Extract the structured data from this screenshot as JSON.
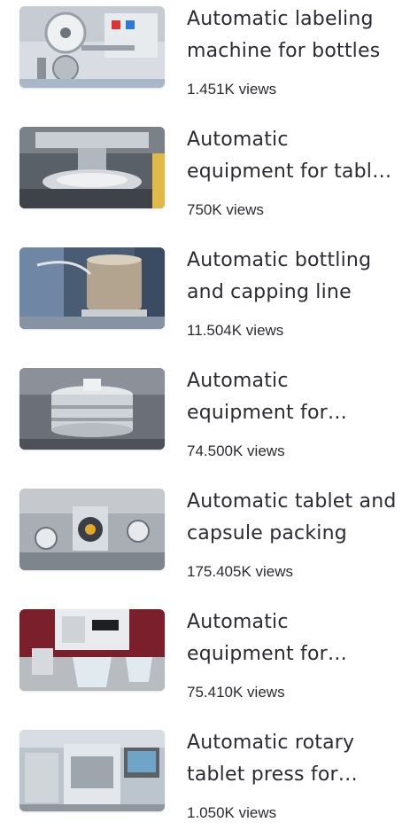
{
  "videos": [
    {
      "title": "Automatic labeling machine for bottles",
      "views": "1.451K views",
      "palette": "lab"
    },
    {
      "title": "Automatic equipment for tablet pressing",
      "views": "750K views",
      "palette": "press"
    },
    {
      "title": "Automatic bottling and capping line",
      "views": "11.504K views",
      "palette": "bottle"
    },
    {
      "title": "Automatic equipment for powder sieving",
      "views": "74.500K views",
      "palette": "sieve"
    },
    {
      "title": "Automatic tablet and capsule packing",
      "views": "175.405K views",
      "palette": "capsule"
    },
    {
      "title": "Automatic equipment for dissolution testing",
      "views": "75.410K views",
      "palette": "dissolve"
    },
    {
      "title": "Automatic rotary tablet press for pharmaceuticals",
      "views": "1.050K views",
      "palette": "rotary"
    }
  ]
}
